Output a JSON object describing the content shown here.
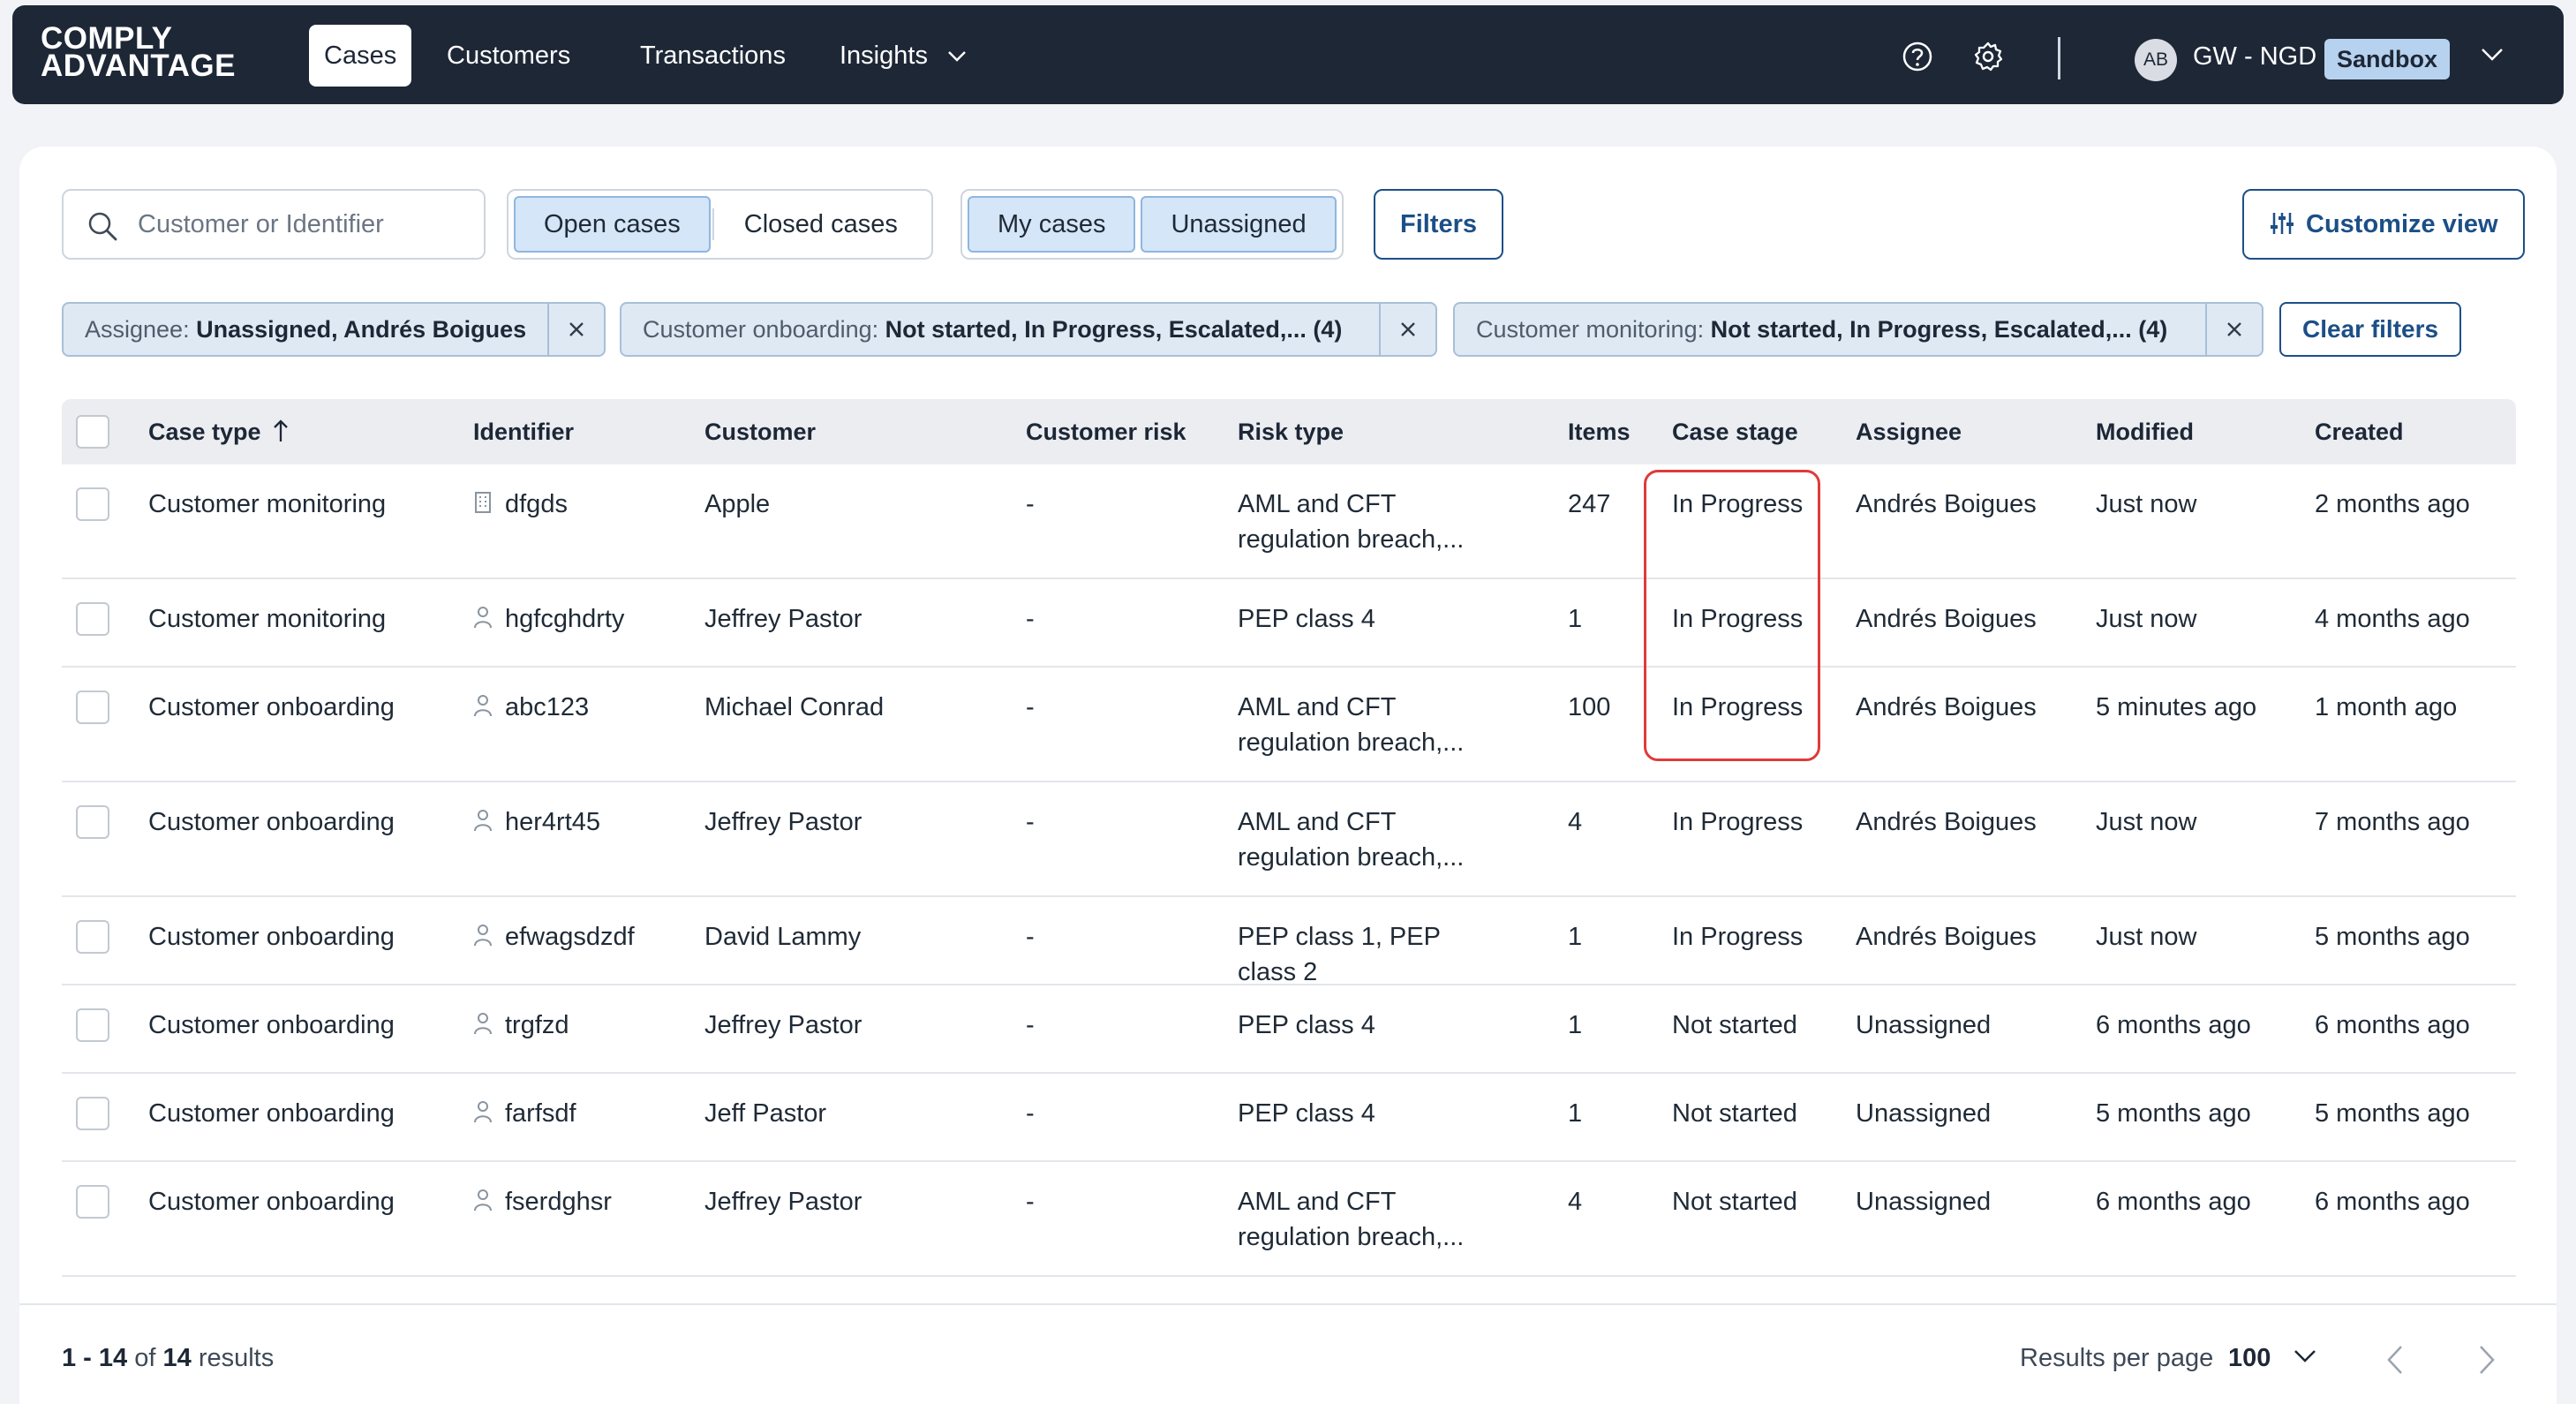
{
  "brand": {
    "line1": "COMPLY",
    "line2": "ADVANTAGE"
  },
  "nav": {
    "items": [
      {
        "label": "Cases"
      },
      {
        "label": "Customers"
      },
      {
        "label": "Transactions"
      },
      {
        "label": "Insights"
      }
    ],
    "account_initials": "AB",
    "account_name": "GW - NGD",
    "environment": "Sandbox"
  },
  "toolbar": {
    "search_placeholder": "Customer or Identifier",
    "open_cases": "Open cases",
    "closed_cases": "Closed cases",
    "my_cases": "My cases",
    "unassigned": "Unassigned",
    "filters": "Filters",
    "customize_view": "Customize view"
  },
  "chips": [
    {
      "label": "Assignee:",
      "value": "Unassigned, Andrés Boigues"
    },
    {
      "label": "Customer onboarding:",
      "value": "Not started, In Progress, Escalated,... (4)"
    },
    {
      "label": "Customer monitoring:",
      "value": "Not started, In Progress, Escalated,... (4)"
    }
  ],
  "clear_filters": "Clear filters",
  "table": {
    "headers": {
      "case_type": "Case type",
      "identifier": "Identifier",
      "customer": "Customer",
      "customer_risk": "Customer risk",
      "risk_type": "Risk type",
      "items": "Items",
      "case_stage": "Case stage",
      "assignee": "Assignee",
      "modified": "Modified",
      "created": "Created"
    },
    "rows": [
      {
        "case_type": "Customer monitoring",
        "id_icon": "building-icon",
        "identifier": "dfgds",
        "customer": "Apple",
        "customer_risk": "-",
        "risk_type": "AML and CFT regulation breach,...",
        "items": "247",
        "case_stage": "In Progress",
        "assignee": "Andrés Boigues",
        "modified": "Just now",
        "created": "2 months ago"
      },
      {
        "case_type": "Customer monitoring",
        "id_icon": "person-icon",
        "identifier": "hgfcghdrty",
        "customer": "Jeffrey Pastor",
        "customer_risk": "-",
        "risk_type": "PEP class 4",
        "items": "1",
        "case_stage": "In Progress",
        "assignee": "Andrés Boigues",
        "modified": "Just now",
        "created": "4 months ago"
      },
      {
        "case_type": "Customer onboarding",
        "id_icon": "person-icon",
        "identifier": "abc123",
        "customer": "Michael Conrad",
        "customer_risk": "-",
        "risk_type": "AML and CFT regulation breach,...",
        "items": "100",
        "case_stage": "In Progress",
        "assignee": "Andrés Boigues",
        "modified": "5 minutes ago",
        "created": "1 month ago"
      },
      {
        "case_type": "Customer onboarding",
        "id_icon": "person-icon",
        "identifier": "her4rt45",
        "customer": "Jeffrey Pastor",
        "customer_risk": "-",
        "risk_type": "AML and CFT regulation breach,...",
        "items": "4",
        "case_stage": "In Progress",
        "assignee": "Andrés Boigues",
        "modified": "Just now",
        "created": "7 months ago"
      },
      {
        "case_type": "Customer onboarding",
        "id_icon": "person-icon",
        "identifier": "efwagsdzdf",
        "customer": "David Lammy",
        "customer_risk": "-",
        "risk_type": "PEP class 1, PEP class 2",
        "items": "1",
        "case_stage": "In Progress",
        "assignee": "Andrés Boigues",
        "modified": "Just now",
        "created": "5 months ago"
      },
      {
        "case_type": "Customer onboarding",
        "id_icon": "person-icon",
        "identifier": "trgfzd",
        "customer": "Jeffrey Pastor",
        "customer_risk": "-",
        "risk_type": "PEP class 4",
        "items": "1",
        "case_stage": "Not started",
        "assignee": "Unassigned",
        "modified": "6 months ago",
        "created": "6 months ago"
      },
      {
        "case_type": "Customer onboarding",
        "id_icon": "person-icon",
        "identifier": "farfsdf",
        "customer": "Jeff Pastor",
        "customer_risk": "-",
        "risk_type": "PEP class 4",
        "items": "1",
        "case_stage": "Not started",
        "assignee": "Unassigned",
        "modified": "5 months ago",
        "created": "5 months ago"
      },
      {
        "case_type": "Customer onboarding",
        "id_icon": "person-icon",
        "identifier": "fserdghsr",
        "customer": "Jeffrey Pastor",
        "customer_risk": "-",
        "risk_type": "AML and CFT regulation breach,...",
        "items": "4",
        "case_stage": "Not started",
        "assignee": "Unassigned",
        "modified": "6 months ago",
        "created": "6 months ago"
      }
    ]
  },
  "footer": {
    "range": "1 - 14",
    "of": "of",
    "total": "14",
    "results_word": "results",
    "results_per_page_label": "Results per page",
    "results_per_page_value": "100"
  },
  "colors": {
    "nav_bg": "#1d2736",
    "accent": "#1c4f87",
    "chip_bg": "#dfe9f4",
    "highlight": "#e03a3a"
  }
}
